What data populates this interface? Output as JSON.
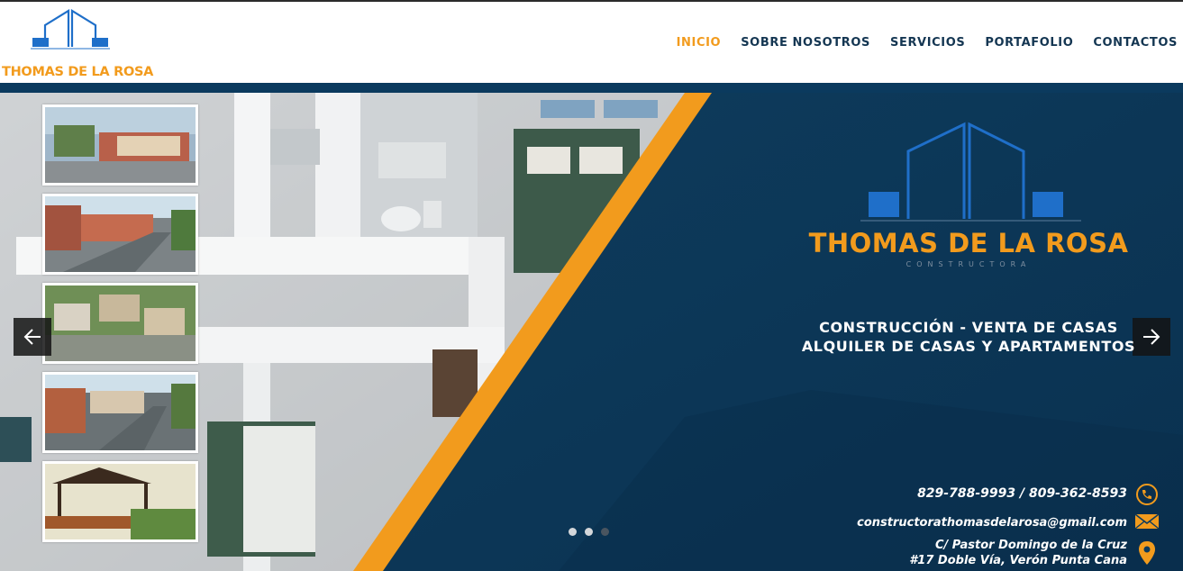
{
  "brand": {
    "logo_text": "THOMAS DE LA ROSA",
    "hero_name": "THOMAS DE LA ROSA",
    "hero_subtitle": "CONSTRUCTORA",
    "logo_icon": "house-outline-logo-icon"
  },
  "nav": {
    "items": [
      {
        "label": "INICIO",
        "active": true
      },
      {
        "label": "SOBRE NOSOTROS",
        "active": false
      },
      {
        "label": "SERVICIOS",
        "active": false
      },
      {
        "label": "PORTAFOLIO",
        "active": false
      },
      {
        "label": "CONTACTOS",
        "active": false
      }
    ]
  },
  "hero": {
    "tagline_line1": "CONSTRUCCIÓN - VENTA DE CASAS",
    "tagline_line2": "ALQUILER DE CASAS Y APARTAMENTOS",
    "prev_icon": "arrow-left-icon",
    "next_icon": "arrow-right-icon",
    "slides_total": 3,
    "active_slide": 1
  },
  "contact": {
    "phone": "829-788-9993 / 809-362-8593",
    "email": "constructorathomasdelarosa@gmail.com",
    "address_line1": "C/ Pastor Domingo de la Cruz",
    "address_line2": "#17 Doble Vía, Verón Punta Cana",
    "icons": [
      "phone-icon",
      "mail-icon",
      "location-pin-icon"
    ]
  },
  "colors": {
    "accent": "#f29b1d",
    "navy": "#0b3a5e",
    "nav_text": "#143652",
    "logo_blue": "#1f6fc9"
  }
}
